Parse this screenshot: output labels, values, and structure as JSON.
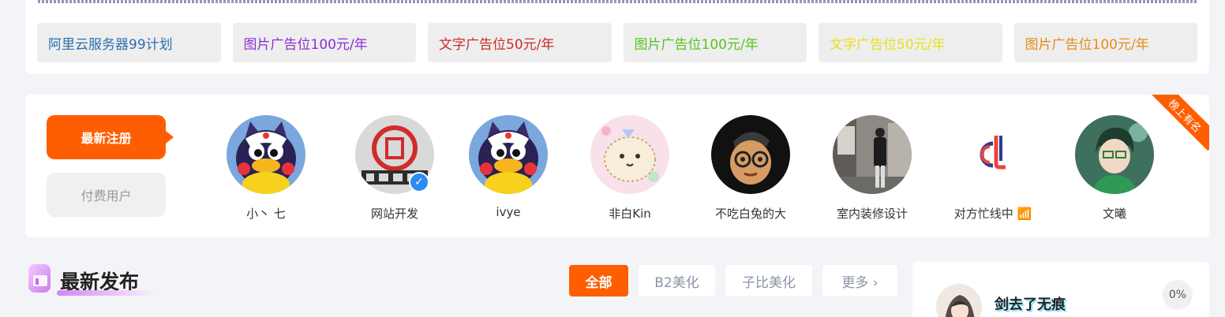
{
  "ads": [
    {
      "label": "阿里云服务器99计划",
      "color": "#2a6fb0"
    },
    {
      "label": "图片广告位100元/年",
      "color": "#8b2fd4"
    },
    {
      "label": "文字广告位50元/年",
      "color": "#d22a2a"
    },
    {
      "label": "图片广告位100元/年",
      "color": "#56c41e"
    },
    {
      "label": "文字广告位50元/年",
      "color": "#e8e01a"
    },
    {
      "label": "图片广告位100元/年",
      "color": "#e88a1a"
    }
  ],
  "users_panel": {
    "latest_tab": "最新注册",
    "paid_tab": "付费用户",
    "ribbon": "榜上有名",
    "users": [
      {
        "name": "小丶 七"
      },
      {
        "name": "网站开发",
        "verified": true
      },
      {
        "name": "ivye"
      },
      {
        "name": "非白Kin"
      },
      {
        "name": "不吃白兔的大"
      },
      {
        "name": "室内装修设计"
      },
      {
        "name": "对方忙线中 📶"
      },
      {
        "name": "文曦"
      }
    ]
  },
  "latest": {
    "title": "最新发布",
    "filters": [
      "全部",
      "B2美化",
      "子比美化",
      "更多 ›"
    ]
  },
  "side": {
    "name": "剑去了无痕",
    "percent": "0%"
  }
}
